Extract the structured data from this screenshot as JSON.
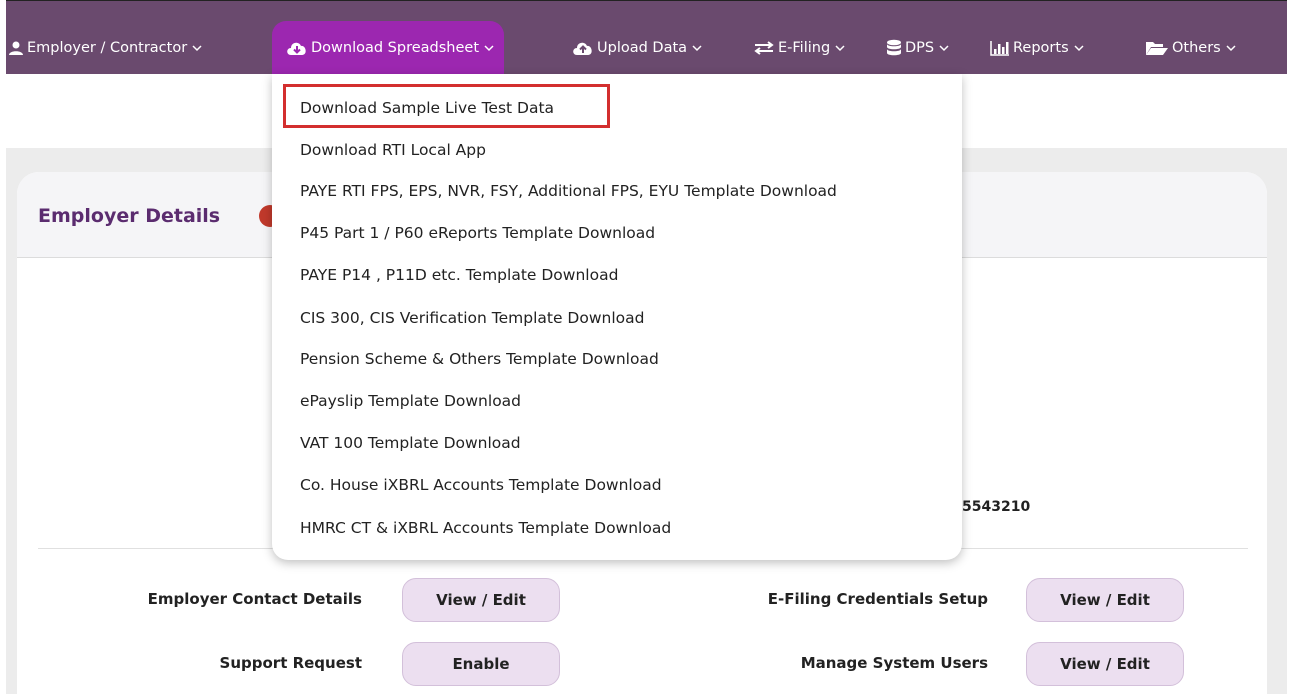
{
  "nav": {
    "items": [
      {
        "label": "Employer / Contractor",
        "icon": "user-icon"
      },
      {
        "label": "Download Spreadsheet",
        "icon": "cloud-download-icon",
        "active": true
      },
      {
        "label": "Upload Data",
        "icon": "cloud-upload-icon"
      },
      {
        "label": "E-Filing",
        "icon": "exchange-icon"
      },
      {
        "label": "DPS",
        "icon": "database-icon"
      },
      {
        "label": "Reports",
        "icon": "bar-chart-icon"
      },
      {
        "label": "Others",
        "icon": "folder-open-icon"
      }
    ]
  },
  "panel": {
    "title": "Employer Details",
    "partial_text_1": ".",
    "partial_text_2": "5543210"
  },
  "rows": [
    {
      "label": "Employer Contact Details",
      "button": "View / Edit"
    },
    {
      "label": "E-Filing Credentials Setup",
      "button": "View / Edit"
    },
    {
      "label": "Support Request",
      "button": "Enable"
    },
    {
      "label": "Manage System Users",
      "button": "View / Edit"
    }
  ],
  "dropdown": {
    "items": [
      "Download Sample Live Test Data",
      "Download RTI Local App",
      "PAYE RTI FPS, EPS, NVR, FSY, Additional FPS, EYU Template Download",
      "P45 Part 1 / P60 eReports Template Download",
      "PAYE P14 , P11D etc. Template Download",
      "CIS 300, CIS Verification Template Download",
      "Pension Scheme & Others Template Download",
      "ePayslip Template Download",
      "VAT 100 Template Download",
      "Co. House iXBRL Accounts Template Download",
      "HMRC CT & iXBRL Accounts Template Download"
    ]
  },
  "colors": {
    "navbar": "#6a4a6e",
    "active_tab": "#9c27b0",
    "title": "#5b2c6f",
    "highlight": "#d32f2f",
    "button_bg": "#ecdff0"
  }
}
